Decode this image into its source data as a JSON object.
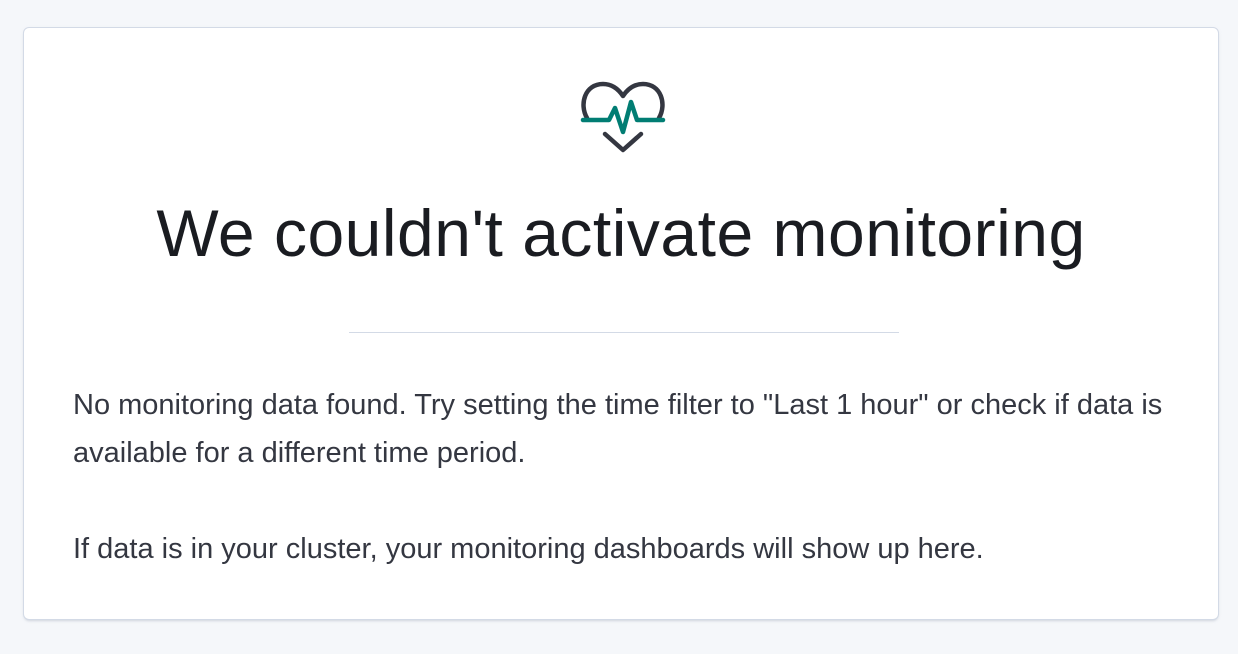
{
  "empty_state": {
    "icon": "monitoring-heart-icon",
    "title": "We couldn't activate monitoring",
    "paragraphs": [
      "No monitoring data found. Try setting the time filter to \"Last 1 hour\" or check if data is available for a different time period.",
      "If data is in your cluster, your monitoring dashboards will show up here."
    ]
  },
  "colors": {
    "icon_dark": "#343741",
    "icon_accent": "#017d73",
    "title": "#1a1c21",
    "body_text": "#343741",
    "border": "#d3dae6",
    "background": "#f5f7fa"
  }
}
